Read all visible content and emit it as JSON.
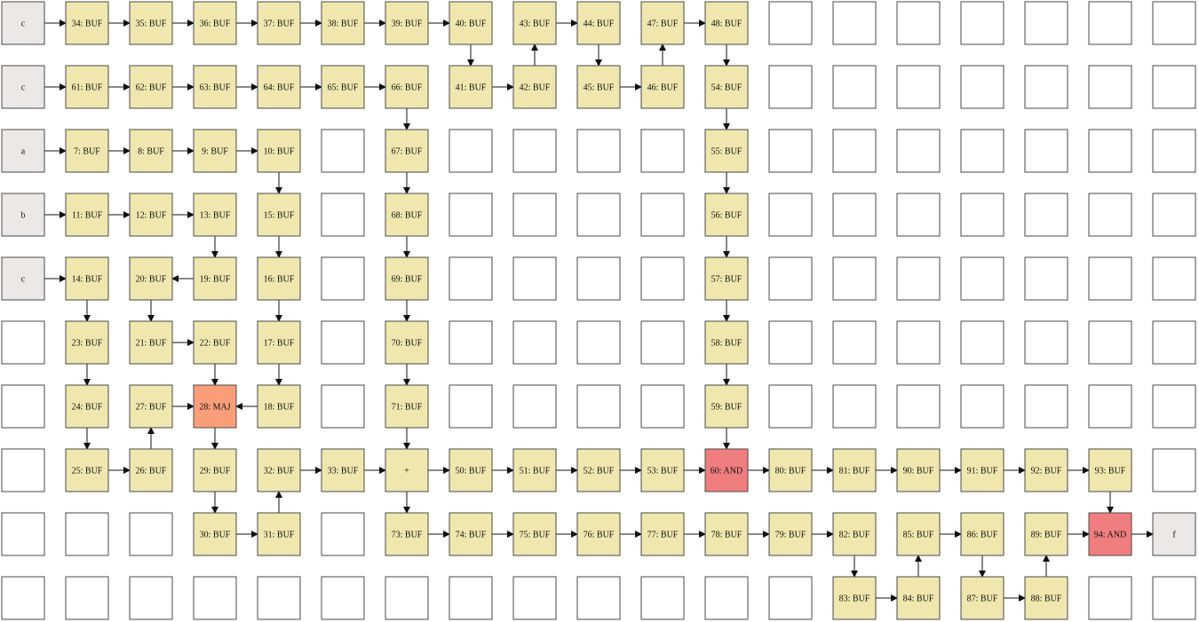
{
  "colors": {
    "empty": "#ffffff",
    "io": "#ece8e6",
    "buf": "#efe7ad",
    "maj": "#fa9e7a",
    "and": "#f07e7e",
    "wire": "#111111",
    "border": "#4a4a4a"
  },
  "grid": {
    "cols": 19,
    "rows": 10
  },
  "cells": [
    {
      "row": 0,
      "col": 0,
      "label": "c",
      "kind": "io"
    },
    {
      "row": 0,
      "col": 1,
      "label": "34: BUF",
      "kind": "buf"
    },
    {
      "row": 0,
      "col": 2,
      "label": "35: BUF",
      "kind": "buf"
    },
    {
      "row": 0,
      "col": 3,
      "label": "36: BUF",
      "kind": "buf"
    },
    {
      "row": 0,
      "col": 4,
      "label": "37: BUF",
      "kind": "buf"
    },
    {
      "row": 0,
      "col": 5,
      "label": "38: BUF",
      "kind": "buf"
    },
    {
      "row": 0,
      "col": 6,
      "label": "39: BUF",
      "kind": "buf"
    },
    {
      "row": 0,
      "col": 7,
      "label": "40: BUF",
      "kind": "buf"
    },
    {
      "row": 0,
      "col": 8,
      "label": "43: BUF",
      "kind": "buf"
    },
    {
      "row": 0,
      "col": 9,
      "label": "44: BUF",
      "kind": "buf"
    },
    {
      "row": 0,
      "col": 10,
      "label": "47: BUF",
      "kind": "buf"
    },
    {
      "row": 0,
      "col": 11,
      "label": "48: BUF",
      "kind": "buf"
    },
    {
      "row": 1,
      "col": 0,
      "label": "c",
      "kind": "io"
    },
    {
      "row": 1,
      "col": 1,
      "label": "61: BUF",
      "kind": "buf"
    },
    {
      "row": 1,
      "col": 2,
      "label": "62: BUF",
      "kind": "buf"
    },
    {
      "row": 1,
      "col": 3,
      "label": "63: BUF",
      "kind": "buf"
    },
    {
      "row": 1,
      "col": 4,
      "label": "64: BUF",
      "kind": "buf"
    },
    {
      "row": 1,
      "col": 5,
      "label": "65: BUF",
      "kind": "buf"
    },
    {
      "row": 1,
      "col": 6,
      "label": "66: BUF",
      "kind": "buf"
    },
    {
      "row": 1,
      "col": 7,
      "label": "41: BUF",
      "kind": "buf"
    },
    {
      "row": 1,
      "col": 8,
      "label": "42: BUF",
      "kind": "buf"
    },
    {
      "row": 1,
      "col": 9,
      "label": "45: BUF",
      "kind": "buf"
    },
    {
      "row": 1,
      "col": 10,
      "label": "46: BUF",
      "kind": "buf"
    },
    {
      "row": 1,
      "col": 11,
      "label": "54: BUF",
      "kind": "buf"
    },
    {
      "row": 2,
      "col": 0,
      "label": "a",
      "kind": "io"
    },
    {
      "row": 2,
      "col": 1,
      "label": "7: BUF",
      "kind": "buf"
    },
    {
      "row": 2,
      "col": 2,
      "label": "8: BUF",
      "kind": "buf"
    },
    {
      "row": 2,
      "col": 3,
      "label": "9: BUF",
      "kind": "buf"
    },
    {
      "row": 2,
      "col": 4,
      "label": "10: BUF",
      "kind": "buf"
    },
    {
      "row": 2,
      "col": 6,
      "label": "67: BUF",
      "kind": "buf"
    },
    {
      "row": 2,
      "col": 11,
      "label": "55: BUF",
      "kind": "buf"
    },
    {
      "row": 3,
      "col": 0,
      "label": "b",
      "kind": "io"
    },
    {
      "row": 3,
      "col": 1,
      "label": "11: BUF",
      "kind": "buf"
    },
    {
      "row": 3,
      "col": 2,
      "label": "12: BUF",
      "kind": "buf"
    },
    {
      "row": 3,
      "col": 3,
      "label": "13: BUF",
      "kind": "buf"
    },
    {
      "row": 3,
      "col": 4,
      "label": "15: BUF",
      "kind": "buf"
    },
    {
      "row": 3,
      "col": 6,
      "label": "68: BUF",
      "kind": "buf"
    },
    {
      "row": 3,
      "col": 11,
      "label": "56: BUF",
      "kind": "buf"
    },
    {
      "row": 4,
      "col": 0,
      "label": "c",
      "kind": "io"
    },
    {
      "row": 4,
      "col": 1,
      "label": "14: BUF",
      "kind": "buf"
    },
    {
      "row": 4,
      "col": 2,
      "label": "20: BUF",
      "kind": "buf"
    },
    {
      "row": 4,
      "col": 3,
      "label": "19: BUF",
      "kind": "buf"
    },
    {
      "row": 4,
      "col": 4,
      "label": "16: BUF",
      "kind": "buf"
    },
    {
      "row": 4,
      "col": 6,
      "label": "69: BUF",
      "kind": "buf"
    },
    {
      "row": 4,
      "col": 11,
      "label": "57: BUF",
      "kind": "buf"
    },
    {
      "row": 5,
      "col": 1,
      "label": "23: BUF",
      "kind": "buf"
    },
    {
      "row": 5,
      "col": 2,
      "label": "21: BUF",
      "kind": "buf"
    },
    {
      "row": 5,
      "col": 3,
      "label": "22: BUF",
      "kind": "buf"
    },
    {
      "row": 5,
      "col": 4,
      "label": "17: BUF",
      "kind": "buf"
    },
    {
      "row": 5,
      "col": 6,
      "label": "70: BUF",
      "kind": "buf"
    },
    {
      "row": 5,
      "col": 11,
      "label": "58: BUF",
      "kind": "buf"
    },
    {
      "row": 6,
      "col": 1,
      "label": "24: BUF",
      "kind": "buf"
    },
    {
      "row": 6,
      "col": 2,
      "label": "27: BUF",
      "kind": "buf"
    },
    {
      "row": 6,
      "col": 3,
      "label": "28: MAJ",
      "kind": "maj"
    },
    {
      "row": 6,
      "col": 4,
      "label": "18: BUF",
      "kind": "buf"
    },
    {
      "row": 6,
      "col": 6,
      "label": "71: BUF",
      "kind": "buf"
    },
    {
      "row": 6,
      "col": 11,
      "label": "59: BUF",
      "kind": "buf"
    },
    {
      "row": 7,
      "col": 1,
      "label": "25: BUF",
      "kind": "buf"
    },
    {
      "row": 7,
      "col": 2,
      "label": "26: BUF",
      "kind": "buf"
    },
    {
      "row": 7,
      "col": 3,
      "label": "29: BUF",
      "kind": "buf"
    },
    {
      "row": 7,
      "col": 4,
      "label": "32: BUF",
      "kind": "buf"
    },
    {
      "row": 7,
      "col": 5,
      "label": "33: BUF",
      "kind": "buf"
    },
    {
      "row": 7,
      "col": 6,
      "label": "+",
      "kind": "buf"
    },
    {
      "row": 7,
      "col": 7,
      "label": "50: BUF",
      "kind": "buf"
    },
    {
      "row": 7,
      "col": 8,
      "label": "51: BUF",
      "kind": "buf"
    },
    {
      "row": 7,
      "col": 9,
      "label": "52: BUF",
      "kind": "buf"
    },
    {
      "row": 7,
      "col": 10,
      "label": "53: BUF",
      "kind": "buf"
    },
    {
      "row": 7,
      "col": 11,
      "label": "60: AND",
      "kind": "and"
    },
    {
      "row": 7,
      "col": 12,
      "label": "80: BUF",
      "kind": "buf"
    },
    {
      "row": 7,
      "col": 13,
      "label": "81: BUF",
      "kind": "buf"
    },
    {
      "row": 7,
      "col": 14,
      "label": "90: BUF",
      "kind": "buf"
    },
    {
      "row": 7,
      "col": 15,
      "label": "91: BUF",
      "kind": "buf"
    },
    {
      "row": 7,
      "col": 16,
      "label": "92: BUF",
      "kind": "buf"
    },
    {
      "row": 7,
      "col": 17,
      "label": "93: BUF",
      "kind": "buf"
    },
    {
      "row": 8,
      "col": 3,
      "label": "30: BUF",
      "kind": "buf"
    },
    {
      "row": 8,
      "col": 4,
      "label": "31: BUF",
      "kind": "buf"
    },
    {
      "row": 8,
      "col": 6,
      "label": "73: BUF",
      "kind": "buf"
    },
    {
      "row": 8,
      "col": 7,
      "label": "74: BUF",
      "kind": "buf"
    },
    {
      "row": 8,
      "col": 8,
      "label": "75: BUF",
      "kind": "buf"
    },
    {
      "row": 8,
      "col": 9,
      "label": "76: BUF",
      "kind": "buf"
    },
    {
      "row": 8,
      "col": 10,
      "label": "77: BUF",
      "kind": "buf"
    },
    {
      "row": 8,
      "col": 11,
      "label": "78: BUF",
      "kind": "buf"
    },
    {
      "row": 8,
      "col": 12,
      "label": "79: BUF",
      "kind": "buf"
    },
    {
      "row": 8,
      "col": 13,
      "label": "82: BUF",
      "kind": "buf"
    },
    {
      "row": 8,
      "col": 14,
      "label": "85: BUF",
      "kind": "buf"
    },
    {
      "row": 8,
      "col": 15,
      "label": "86: BUF",
      "kind": "buf"
    },
    {
      "row": 8,
      "col": 16,
      "label": "89: BUF",
      "kind": "buf"
    },
    {
      "row": 8,
      "col": 17,
      "label": "94: AND",
      "kind": "and"
    },
    {
      "row": 8,
      "col": 18,
      "label": "f",
      "kind": "io"
    },
    {
      "row": 9,
      "col": 13,
      "label": "83: BUF",
      "kind": "buf"
    },
    {
      "row": 9,
      "col": 14,
      "label": "84: BUF",
      "kind": "buf"
    },
    {
      "row": 9,
      "col": 15,
      "label": "87: BUF",
      "kind": "buf"
    },
    {
      "row": 9,
      "col": 16,
      "label": "88: BUF",
      "kind": "buf"
    }
  ],
  "wires": [
    {
      "from": [
        0,
        0
      ],
      "to": [
        0,
        1
      ]
    },
    {
      "from": [
        0,
        1
      ],
      "to": [
        0,
        2
      ]
    },
    {
      "from": [
        0,
        2
      ],
      "to": [
        0,
        3
      ]
    },
    {
      "from": [
        0,
        3
      ],
      "to": [
        0,
        4
      ]
    },
    {
      "from": [
        0,
        4
      ],
      "to": [
        0,
        5
      ]
    },
    {
      "from": [
        0,
        5
      ],
      "to": [
        0,
        6
      ]
    },
    {
      "from": [
        0,
        6
      ],
      "to": [
        0,
        7
      ]
    },
    {
      "from": [
        0,
        7
      ],
      "to": [
        1,
        7
      ]
    },
    {
      "from": [
        1,
        7
      ],
      "to": [
        1,
        8
      ]
    },
    {
      "from": [
        1,
        8
      ],
      "to": [
        0,
        8
      ]
    },
    {
      "from": [
        0,
        8
      ],
      "to": [
        0,
        9
      ]
    },
    {
      "from": [
        0,
        9
      ],
      "to": [
        1,
        9
      ]
    },
    {
      "from": [
        1,
        9
      ],
      "to": [
        1,
        10
      ]
    },
    {
      "from": [
        1,
        10
      ],
      "to": [
        0,
        10
      ]
    },
    {
      "from": [
        0,
        10
      ],
      "to": [
        0,
        11
      ]
    },
    {
      "from": [
        0,
        11
      ],
      "to": [
        1,
        11
      ]
    },
    {
      "from": [
        1,
        11
      ],
      "to": [
        2,
        11
      ]
    },
    {
      "from": [
        2,
        11
      ],
      "to": [
        3,
        11
      ]
    },
    {
      "from": [
        3,
        11
      ],
      "to": [
        4,
        11
      ]
    },
    {
      "from": [
        4,
        11
      ],
      "to": [
        5,
        11
      ]
    },
    {
      "from": [
        5,
        11
      ],
      "to": [
        6,
        11
      ]
    },
    {
      "from": [
        6,
        11
      ],
      "to": [
        7,
        11
      ]
    },
    {
      "from": [
        1,
        0
      ],
      "to": [
        1,
        1
      ]
    },
    {
      "from": [
        1,
        1
      ],
      "to": [
        1,
        2
      ]
    },
    {
      "from": [
        1,
        2
      ],
      "to": [
        1,
        3
      ]
    },
    {
      "from": [
        1,
        3
      ],
      "to": [
        1,
        4
      ]
    },
    {
      "from": [
        1,
        4
      ],
      "to": [
        1,
        5
      ]
    },
    {
      "from": [
        1,
        5
      ],
      "to": [
        1,
        6
      ]
    },
    {
      "from": [
        1,
        6
      ],
      "to": [
        2,
        6
      ]
    },
    {
      "from": [
        2,
        6
      ],
      "to": [
        3,
        6
      ]
    },
    {
      "from": [
        3,
        6
      ],
      "to": [
        4,
        6
      ]
    },
    {
      "from": [
        4,
        6
      ],
      "to": [
        5,
        6
      ]
    },
    {
      "from": [
        5,
        6
      ],
      "to": [
        6,
        6
      ]
    },
    {
      "from": [
        6,
        6
      ],
      "to": [
        7,
        6
      ]
    },
    {
      "from": [
        7,
        6
      ],
      "to": [
        7,
        7
      ]
    },
    {
      "from": [
        7,
        6
      ],
      "to": [
        8,
        6
      ]
    },
    {
      "from": [
        2,
        0
      ],
      "to": [
        2,
        1
      ]
    },
    {
      "from": [
        2,
        1
      ],
      "to": [
        2,
        2
      ]
    },
    {
      "from": [
        2,
        2
      ],
      "to": [
        2,
        3
      ]
    },
    {
      "from": [
        2,
        3
      ],
      "to": [
        2,
        4
      ]
    },
    {
      "from": [
        2,
        4
      ],
      "to": [
        3,
        4
      ]
    },
    {
      "from": [
        3,
        4
      ],
      "to": [
        4,
        4
      ]
    },
    {
      "from": [
        4,
        4
      ],
      "to": [
        5,
        4
      ]
    },
    {
      "from": [
        5,
        4
      ],
      "to": [
        6,
        4
      ]
    },
    {
      "from": [
        6,
        4
      ],
      "to": [
        6,
        3
      ]
    },
    {
      "from": [
        3,
        0
      ],
      "to": [
        3,
        1
      ]
    },
    {
      "from": [
        3,
        1
      ],
      "to": [
        3,
        2
      ]
    },
    {
      "from": [
        3,
        2
      ],
      "to": [
        3,
        3
      ]
    },
    {
      "from": [
        3,
        3
      ],
      "to": [
        4,
        3
      ]
    },
    {
      "from": [
        4,
        3
      ],
      "to": [
        4,
        2
      ]
    },
    {
      "from": [
        4,
        2
      ],
      "to": [
        5,
        2
      ]
    },
    {
      "from": [
        5,
        2
      ],
      "to": [
        5,
        3
      ]
    },
    {
      "from": [
        5,
        3
      ],
      "to": [
        6,
        3
      ]
    },
    {
      "from": [
        4,
        0
      ],
      "to": [
        4,
        1
      ]
    },
    {
      "from": [
        4,
        1
      ],
      "to": [
        5,
        1
      ]
    },
    {
      "from": [
        5,
        1
      ],
      "to": [
        6,
        1
      ]
    },
    {
      "from": [
        6,
        1
      ],
      "to": [
        7,
        1
      ]
    },
    {
      "from": [
        7,
        1
      ],
      "to": [
        7,
        2
      ]
    },
    {
      "from": [
        7,
        2
      ],
      "to": [
        6,
        2
      ]
    },
    {
      "from": [
        6,
        2
      ],
      "to": [
        6,
        3
      ]
    },
    {
      "from": [
        6,
        3
      ],
      "to": [
        7,
        3
      ]
    },
    {
      "from": [
        7,
        3
      ],
      "to": [
        8,
        3
      ]
    },
    {
      "from": [
        8,
        3
      ],
      "to": [
        8,
        4
      ]
    },
    {
      "from": [
        8,
        4
      ],
      "to": [
        7,
        4
      ]
    },
    {
      "from": [
        7,
        4
      ],
      "to": [
        7,
        5
      ]
    },
    {
      "from": [
        7,
        5
      ],
      "to": [
        7,
        6
      ]
    },
    {
      "from": [
        7,
        7
      ],
      "to": [
        7,
        8
      ]
    },
    {
      "from": [
        7,
        8
      ],
      "to": [
        7,
        9
      ]
    },
    {
      "from": [
        7,
        9
      ],
      "to": [
        7,
        10
      ]
    },
    {
      "from": [
        7,
        10
      ],
      "to": [
        7,
        11
      ]
    },
    {
      "from": [
        7,
        11
      ],
      "to": [
        7,
        12
      ]
    },
    {
      "from": [
        7,
        12
      ],
      "to": [
        7,
        13
      ]
    },
    {
      "from": [
        7,
        13
      ],
      "to": [
        7,
        14
      ]
    },
    {
      "from": [
        7,
        14
      ],
      "to": [
        7,
        15
      ]
    },
    {
      "from": [
        7,
        15
      ],
      "to": [
        7,
        16
      ]
    },
    {
      "from": [
        7,
        16
      ],
      "to": [
        7,
        17
      ]
    },
    {
      "from": [
        7,
        17
      ],
      "to": [
        8,
        17
      ]
    },
    {
      "from": [
        8,
        6
      ],
      "to": [
        8,
        7
      ]
    },
    {
      "from": [
        8,
        7
      ],
      "to": [
        8,
        8
      ]
    },
    {
      "from": [
        8,
        8
      ],
      "to": [
        8,
        9
      ]
    },
    {
      "from": [
        8,
        9
      ],
      "to": [
        8,
        10
      ]
    },
    {
      "from": [
        8,
        10
      ],
      "to": [
        8,
        11
      ]
    },
    {
      "from": [
        8,
        11
      ],
      "to": [
        8,
        12
      ]
    },
    {
      "from": [
        8,
        12
      ],
      "to": [
        8,
        13
      ]
    },
    {
      "from": [
        8,
        13
      ],
      "to": [
        9,
        13
      ]
    },
    {
      "from": [
        9,
        13
      ],
      "to": [
        9,
        14
      ]
    },
    {
      "from": [
        9,
        14
      ],
      "to": [
        8,
        14
      ]
    },
    {
      "from": [
        8,
        14
      ],
      "to": [
        8,
        15
      ]
    },
    {
      "from": [
        8,
        15
      ],
      "to": [
        9,
        15
      ]
    },
    {
      "from": [
        9,
        15
      ],
      "to": [
        9,
        16
      ]
    },
    {
      "from": [
        9,
        16
      ],
      "to": [
        8,
        16
      ]
    },
    {
      "from": [
        8,
        16
      ],
      "to": [
        8,
        17
      ]
    },
    {
      "from": [
        8,
        17
      ],
      "to": [
        8,
        18
      ]
    }
  ]
}
